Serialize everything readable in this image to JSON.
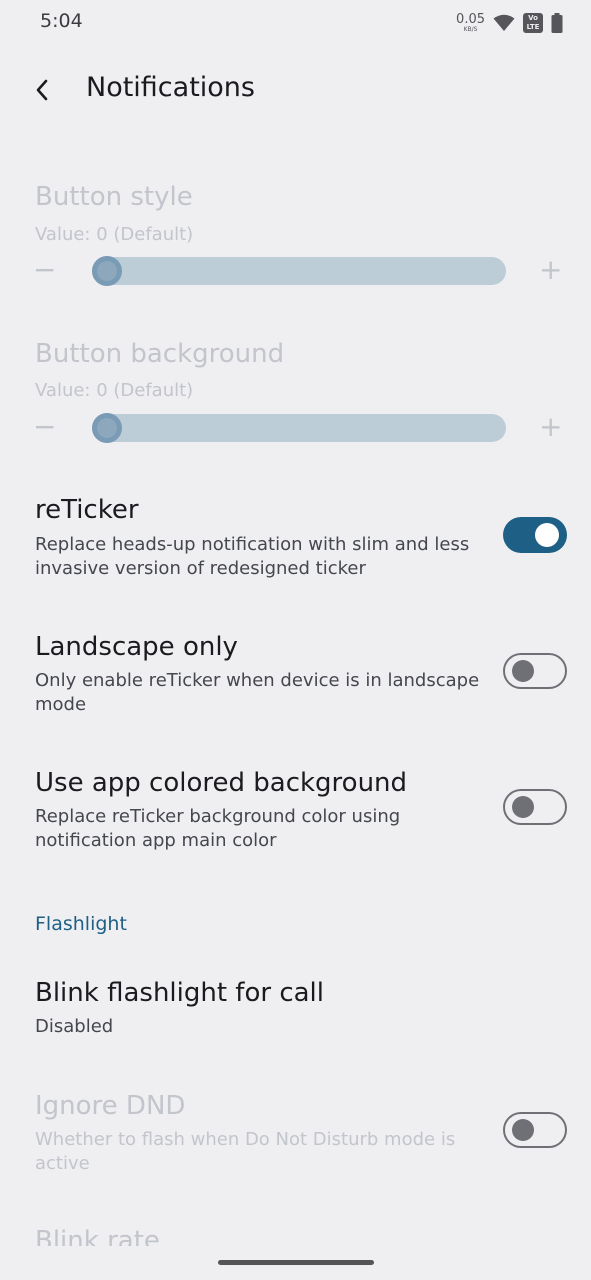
{
  "status_bar": {
    "time": "5:04",
    "net_speed": "0.05",
    "net_unit": "KB/S",
    "volte_top": "Vo",
    "volte_bottom": "LTE",
    "icons": [
      "wifi-icon",
      "volte-icon",
      "battery-icon"
    ]
  },
  "toolbar": {
    "title": "Notifications",
    "back_icon": "back-arrow-icon"
  },
  "button_style": {
    "title": "Button style",
    "summary": "Value: 0 (Default)",
    "minus": "−",
    "plus": "+",
    "value": 0,
    "enabled": false
  },
  "button_background": {
    "title": "Button background",
    "summary": "Value: 0 (Default)",
    "minus": "−",
    "plus": "+",
    "value": 0,
    "enabled": false
  },
  "reticker": {
    "title": "reTicker",
    "summary": "Replace heads-up notification with slim and less invasive version of redesigned ticker",
    "checked": true
  },
  "landscape_only": {
    "title": "Landscape only",
    "summary": "Only enable reTicker when device is in landscape mode",
    "checked": false
  },
  "app_colored_bg": {
    "title": "Use app colored background",
    "summary": "Replace reTicker background color using notification app main color",
    "checked": false
  },
  "flashlight_section": {
    "header": "Flashlight"
  },
  "blink_flashlight": {
    "title": "Blink flashlight for call",
    "summary": "Disabled"
  },
  "ignore_dnd": {
    "title": "Ignore DND",
    "summary": "Whether to flash when Do Not Disturb mode is active",
    "checked": false,
    "enabled": false
  },
  "blink_rate": {
    "title": "Blink rate"
  },
  "colors": {
    "accent": "#1e5f85",
    "background": "#efeff2",
    "disabled_text": "#c3c5cc"
  }
}
